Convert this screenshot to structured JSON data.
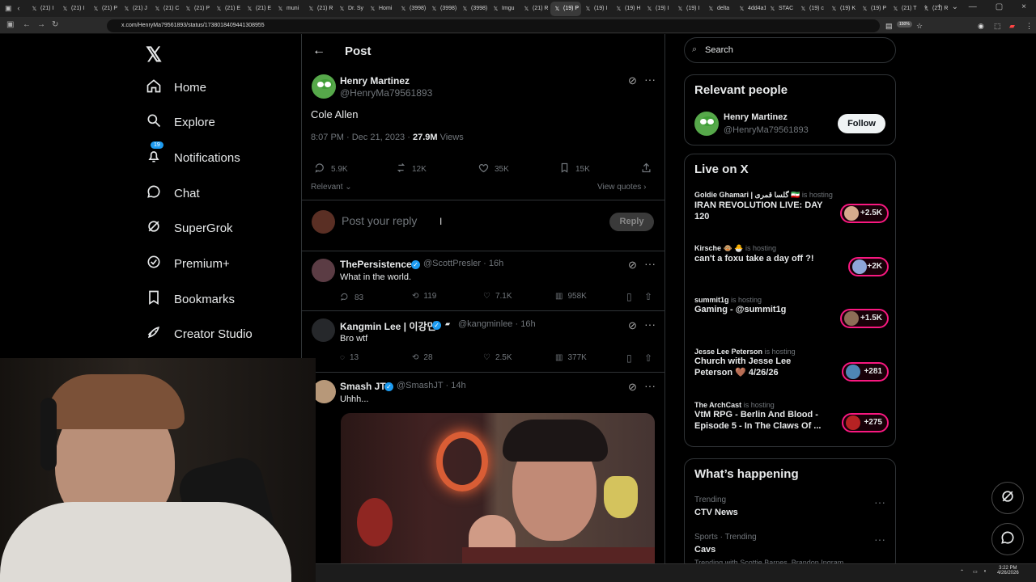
{
  "browser": {
    "tabs": [
      "(21) I",
      "(21) I",
      "(21) P",
      "(21) J",
      "(21) C",
      "(21) P",
      "(21) E",
      "(21) E",
      "muni",
      "(21) R",
      "Dr. Sy",
      "Homi",
      "(3998)",
      "(3998)",
      "(3998)",
      "Imgu",
      "(21) R",
      "(19) P",
      "(19) I",
      "(19) H",
      "(19) I",
      "(19) I",
      "delta",
      "4dd4a14c",
      "STAC",
      "(19) c",
      "(19) K",
      "(19) P",
      "(21) T",
      "(21) R"
    ],
    "url": "x.com/HenryMa79561893/status/1738018409441308955",
    "zoom": "150%"
  },
  "sidebar": {
    "logo": "𝕏",
    "items": [
      {
        "label": "Home",
        "icon": "home-icon"
      },
      {
        "label": "Explore",
        "icon": "search-icon"
      },
      {
        "label": "Notifications",
        "icon": "bell-icon",
        "badge": "19"
      },
      {
        "label": "Chat",
        "icon": "chat-icon"
      },
      {
        "label": "SuperGrok",
        "icon": "grok-icon"
      },
      {
        "label": "Premium+",
        "icon": "verified-icon"
      },
      {
        "label": "Bookmarks",
        "icon": "bookmark-icon"
      },
      {
        "label": "Creator Studio",
        "icon": "rocket-icon"
      }
    ]
  },
  "post": {
    "header": "Post",
    "author_name": "Henry Martinez",
    "author_handle": "@HenryMa79561893",
    "text": "Cole Allen",
    "time": "8:07 PM · Dec 21, 2023 · ",
    "views_count": "27.9M",
    "views_label": "Views",
    "replies": "5.9K",
    "reposts": "12K",
    "likes": "35K",
    "bookmarks": "15K",
    "relevant": "Relevant",
    "view_quotes": "View quotes",
    "reply_placeholder": "Post your reply",
    "reply_button": "Reply"
  },
  "replies": [
    {
      "name": "ThePersistence",
      "handle": "@ScottPresler",
      "time": "· 16h",
      "text": "What in the world.",
      "replies": "83",
      "reposts": "119",
      "likes": "7.1K",
      "views": "958K"
    },
    {
      "name": "Kangmin Lee | 이강민",
      "handle": "@kangminlee",
      "time": "· 16h",
      "text": "Bro wtf",
      "replies": "13",
      "reposts": "28",
      "likes": "2.5K",
      "views": "377K"
    },
    {
      "name": "Smash JT",
      "handle": "@SmashJT",
      "time": "· 14h",
      "text": "Uhhh..."
    }
  ],
  "right": {
    "search_placeholder": "Search",
    "relevant_title": "Relevant people",
    "relevant_name": "Henry Martinez",
    "relevant_handle": "@HenryMa79561893",
    "follow": "Follow",
    "live_title": "Live on X",
    "live": [
      {
        "host": "Goldie Ghamari | گلسا قمری 🇮🇷",
        "suffix": "is hosting",
        "title": "IRAN REVOLUTION LIVE: DAY 120",
        "count": "+2.5K"
      },
      {
        "host": "Kirsche 🐵 🐣",
        "suffix": "is hosting",
        "title": "can't a foxu take a day off ?!",
        "count": "+2K"
      },
      {
        "host": "summit1g",
        "suffix": "is hosting",
        "title": "Gaming - @summit1g",
        "count": "+1.5K"
      },
      {
        "host": "Jesse Lee Peterson",
        "suffix": "is hosting",
        "title": "Church with Jesse Lee Peterson 🤎 4/26/26",
        "count": "+281"
      },
      {
        "host": "The ArchCast",
        "suffix": "is hosting",
        "title": "VtM RPG - Berlin And Blood - Episode 5 - In The Claws Of ...",
        "count": "+275"
      }
    ],
    "happening_title": "What’s happening",
    "trends": [
      {
        "category": "Trending",
        "name": "CTV News"
      },
      {
        "category": "Sports · Trending",
        "name": "Cavs"
      }
    ],
    "trend_footer": "Trending with Scottie Barnes, Brandon Ingram"
  },
  "taskbar": {
    "time": "3:22 PM",
    "date": "4/26/2026"
  },
  "colors": {
    "accent": "#1d9bf0",
    "live": "#f91880",
    "border": "#2f3336",
    "muted": "#71767b"
  }
}
